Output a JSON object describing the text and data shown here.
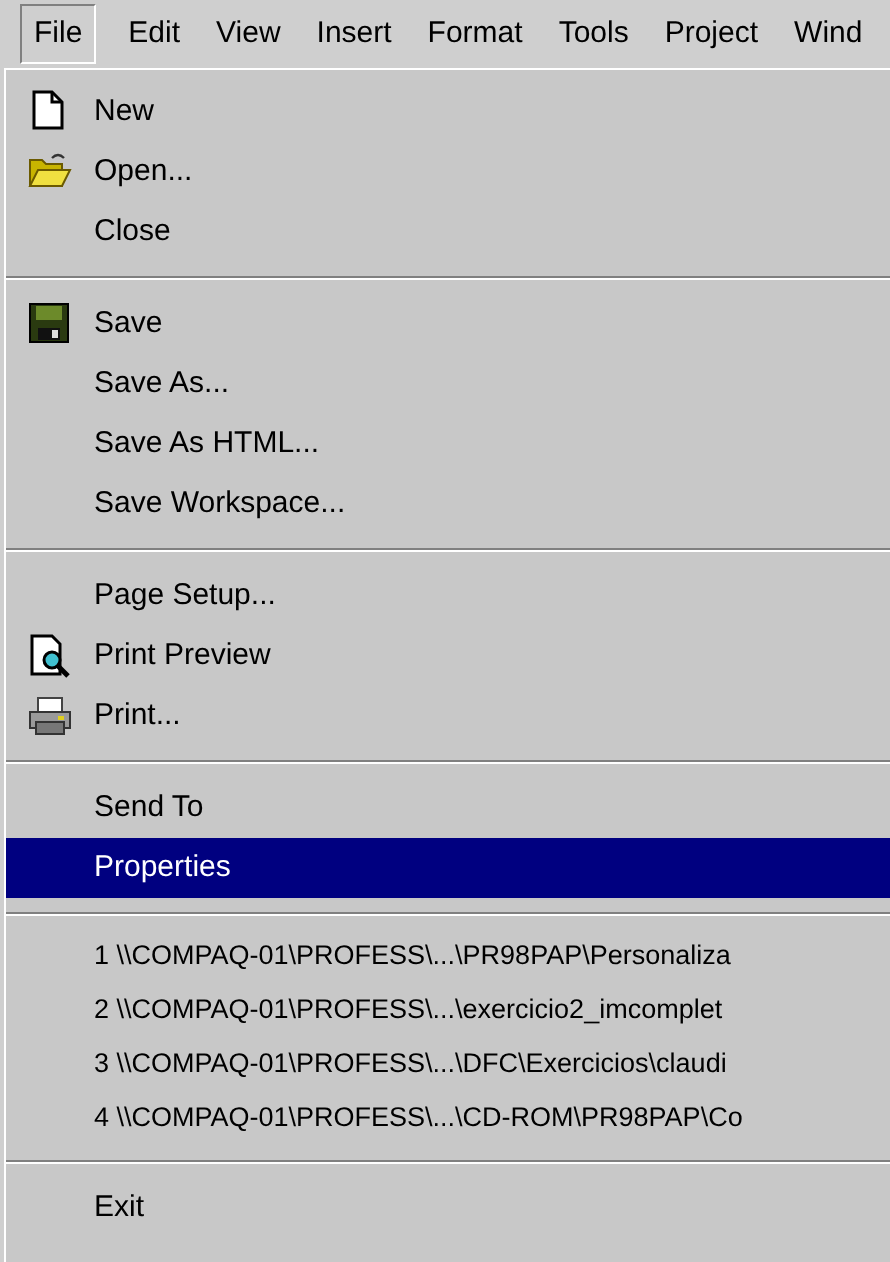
{
  "menu_bar": [
    {
      "label": "File",
      "selected": true
    },
    {
      "label": "Edit",
      "selected": false
    },
    {
      "label": "View",
      "selected": false
    },
    {
      "label": "Insert",
      "selected": false
    },
    {
      "label": "Format",
      "selected": false
    },
    {
      "label": "Tools",
      "selected": false
    },
    {
      "label": "Project",
      "selected": false
    },
    {
      "label": "Wind",
      "selected": false
    }
  ],
  "file_menu": {
    "items": [
      {
        "kind": "item",
        "label": "New",
        "selected": false
      },
      {
        "kind": "item",
        "label": "Open...",
        "selected": false
      },
      {
        "kind": "item",
        "label": "Close",
        "selected": false
      },
      {
        "kind": "separator"
      },
      {
        "kind": "item",
        "label": "Save",
        "selected": false
      },
      {
        "kind": "item",
        "label": "Save As...",
        "selected": false
      },
      {
        "kind": "item",
        "label": "Save As HTML...",
        "selected": false
      },
      {
        "kind": "item",
        "label": "Save Workspace...",
        "selected": false
      },
      {
        "kind": "separator"
      },
      {
        "kind": "item",
        "label": "Page Setup...",
        "selected": false
      },
      {
        "kind": "item",
        "label": "Print Preview",
        "selected": false
      },
      {
        "kind": "item",
        "label": "Print...",
        "selected": false
      },
      {
        "kind": "separator"
      },
      {
        "kind": "item",
        "label": "Send To",
        "selected": false
      },
      {
        "kind": "item",
        "label": "Properties",
        "selected": true
      },
      {
        "kind": "separator"
      },
      {
        "kind": "recent",
        "label": "1 \\\\COMPAQ-01\\PROFESS\\...\\PR98PAP\\Personaliza",
        "selected": false
      },
      {
        "kind": "recent",
        "label": "2 \\\\COMPAQ-01\\PROFESS\\...\\exercicio2_imcomplet",
        "selected": false
      },
      {
        "kind": "recent",
        "label": "3 \\\\COMPAQ-01\\PROFESS\\...\\DFC\\Exercicios\\claudi",
        "selected": false
      },
      {
        "kind": "recent",
        "label": "4 \\\\COMPAQ-01\\PROFESS\\...\\CD-ROM\\PR98PAP\\Co",
        "selected": false
      },
      {
        "kind": "separator"
      },
      {
        "kind": "item",
        "label": "Exit",
        "selected": false
      }
    ]
  }
}
